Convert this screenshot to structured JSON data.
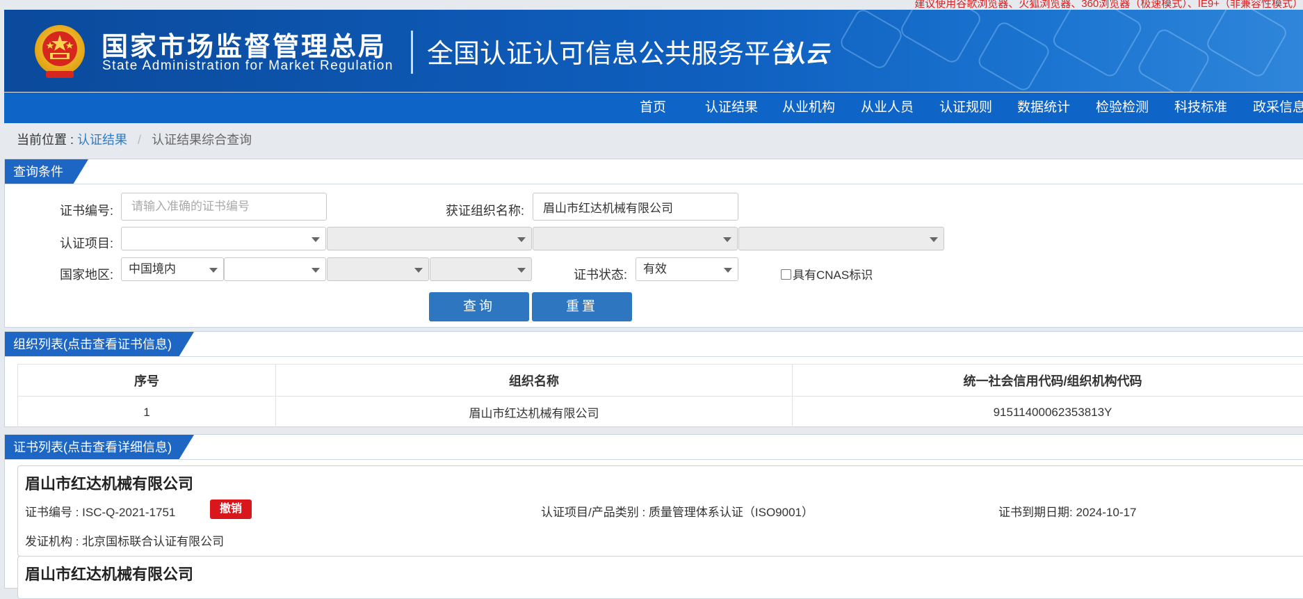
{
  "notice": "建议使用谷歌浏览器、火狐浏览器、360浏览器（极速模式）、IE9+（非兼容性模式）",
  "header": {
    "org_name_cn": "国家市场监督管理总局",
    "org_name_en": "State Administration for Market Regulation",
    "platform_title": "全国认证认可信息公共服务平台",
    "logo_text": "认云"
  },
  "nav": {
    "items": [
      "首页",
      "认证结果",
      "从业机构",
      "从业人员",
      "认证规则",
      "数据统计",
      "检验检测",
      "科技标准",
      "政采信息"
    ]
  },
  "breadcrumb": {
    "prefix": "当前位置 :",
    "link": "认证结果",
    "separator": "/",
    "current": "认证结果综合查询"
  },
  "query": {
    "tab_label": "查询条件",
    "cert_no_label": "证书编号:",
    "cert_no_placeholder": "请输入准确的证书编号",
    "cert_no_value": "",
    "org_name_label": "获证组织名称:",
    "org_name_value": "眉山市红达机械有限公司",
    "project_label": "认证项目:",
    "region_label": "国家地区:",
    "region_value": "中国境内",
    "status_label": "证书状态:",
    "status_value": "有效",
    "cnas_label": "具有CNAS标识",
    "search_button": "查询",
    "reset_button": "重置"
  },
  "org_list": {
    "tab_label": "组织列表(点击查看证书信息)",
    "columns": [
      "序号",
      "组织名称",
      "统一社会信用代码/组织机构代码"
    ],
    "rows": [
      {
        "index": "1",
        "name": "眉山市红达机械有限公司",
        "code": "91511400062353813Y"
      }
    ]
  },
  "cert_list": {
    "tab_label": "证书列表(点击查看详细信息)",
    "cards": [
      {
        "org_name": "眉山市红达机械有限公司",
        "cert_no": "证书编号 : ISC-Q-2021-1751",
        "status_badge": "撤销",
        "project": "认证项目/产品类别 : 质量管理体系认证（ISO9001）",
        "expiry": "证书到期日期: 2024-10-17",
        "issuer": "发证机构 : 北京国标联合认证有限公司"
      },
      {
        "org_name": "眉山市红达机械有限公司"
      }
    ]
  },
  "colors": {
    "banner_blue": "#0f5fbf",
    "nav_blue": "#0f64c8",
    "tab_blue": "#1e66c4",
    "button_blue": "#2e76bf",
    "link_blue": "#2f7cc6",
    "badge_red": "#d9161c",
    "notice_red": "#d62222"
  }
}
